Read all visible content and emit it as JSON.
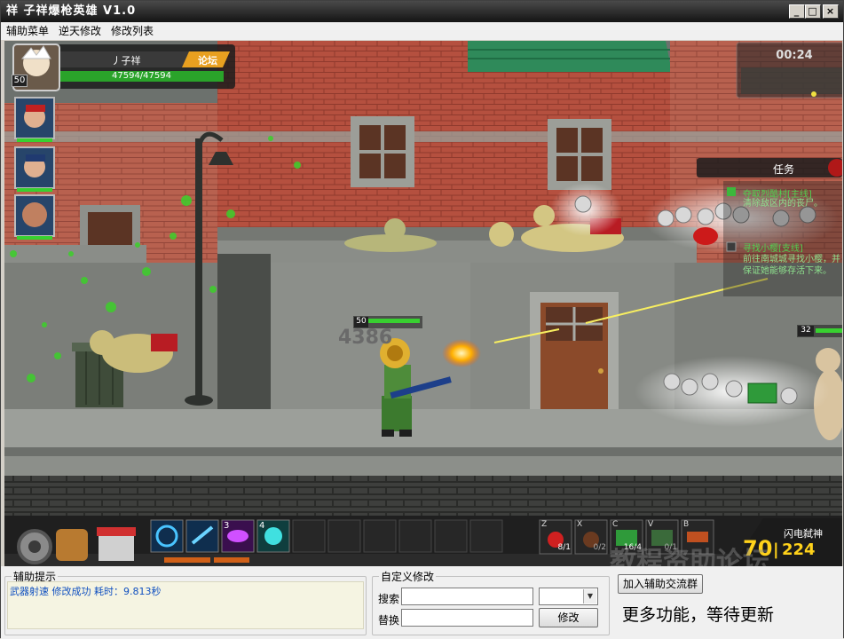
{
  "window": {
    "title": "祥 子祥爆枪英雄 V1.0",
    "minimize_glyph": "_",
    "maximize_glyph": "□",
    "close_glyph": "×"
  },
  "menu": [
    "辅助菜单",
    "逆天修改",
    "修改列表"
  ],
  "game": {
    "player": {
      "name": "丿子祥",
      "level": "50",
      "hp": "47594/47594",
      "forum_button": "论坛"
    },
    "timer": "00:24",
    "quest": {
      "header": "任务",
      "items": [
        {
          "title": "夺取烈酷村[主线]",
          "desc": "清除敌区内的丧尸。"
        },
        {
          "title": "寻找小樱[支线]",
          "desc": "前往南城城寻找小樱，并保证她能够存活下来。"
        }
      ]
    },
    "hero_level": "50",
    "damage_text": "4386",
    "enemy_level": "32",
    "skills": [
      {
        "key": "",
        "icon": "swirl-icon"
      },
      {
        "key": "",
        "icon": "blade-icon"
      },
      {
        "key": "3",
        "icon": "eye-icon"
      },
      {
        "key": "4",
        "icon": "skull-icon"
      }
    ],
    "items": [
      {
        "key": "Z",
        "count": "8/1",
        "icon": "potion-icon"
      },
      {
        "key": "X",
        "count": "0/2",
        "icon": "bomb-icon"
      },
      {
        "key": "C",
        "count": "16/4",
        "icon": "ammo-box-icon"
      },
      {
        "key": "V",
        "count": "0/1",
        "icon": "crate-icon"
      },
      {
        "key": "B",
        "count": "",
        "icon": "rocket-icon"
      }
    ],
    "weapon": {
      "name": "闪电弑神",
      "ammo": "70",
      "reserve": "224"
    },
    "watermark": "教程资助论坛"
  },
  "bottom": {
    "hint_group": "辅助提示",
    "hint_text": "武器射速 修改成功 耗时：9.813秒",
    "custom_group": "自定义修改",
    "search_label": "搜索",
    "replace_label": "替换",
    "modify_button": "修改",
    "join_button": "加入辅助交流群",
    "more_text": "更多功能，等待更新"
  }
}
